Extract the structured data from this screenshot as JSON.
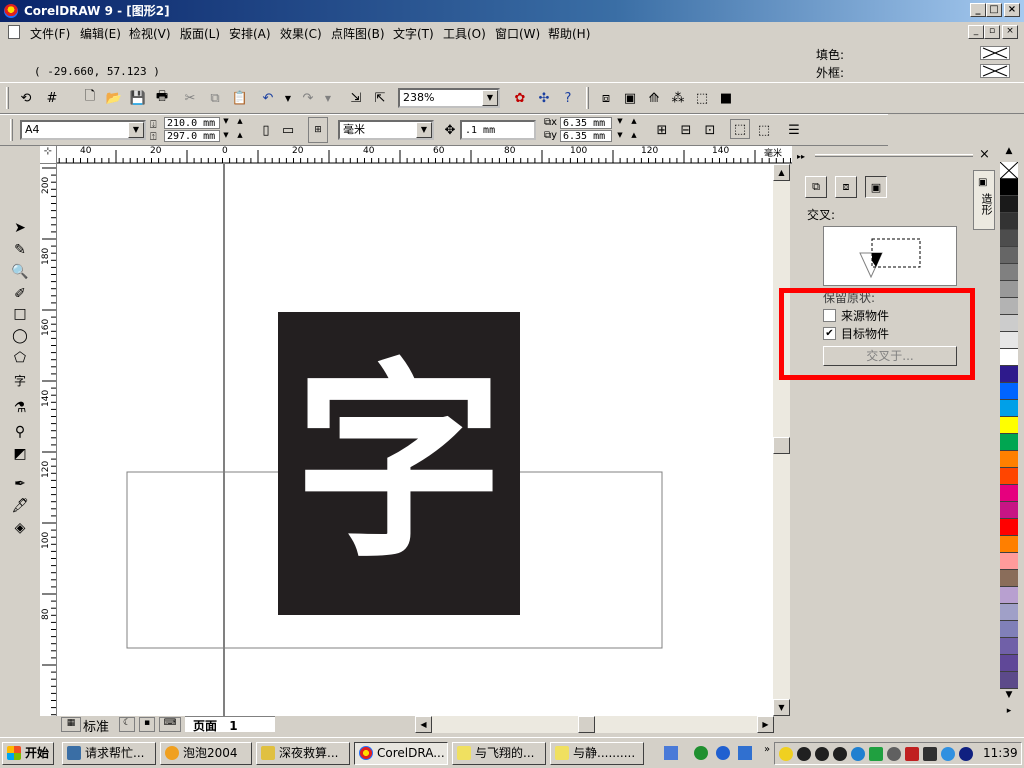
{
  "window": {
    "title": "CorelDRAW 9 - [图形2]"
  },
  "menu": [
    "文件(F)",
    "编辑(E)",
    "检视(V)",
    "版面(L)",
    "安排(A)",
    "效果(C)",
    "点阵图(B)",
    "文字(T)",
    "工具(O)",
    "窗口(W)",
    "帮助(H)"
  ],
  "status": {
    "coordinates": "( -29.660, 57.123 )",
    "fill_label": "填色:",
    "outline_label": "外框:"
  },
  "standard_toolbar": {
    "zoom": "238%"
  },
  "property_bar": {
    "paper": "A4",
    "width": "210.0 mm",
    "height": "297.0 mm",
    "units": "毫米",
    "nudge": ".1 mm",
    "dup_x": "6.35 mm",
    "dup_y": "6.35 mm"
  },
  "rulers": {
    "horizontal_ticks": [
      "40",
      "20",
      "0",
      "20",
      "40",
      "60",
      "80",
      "100",
      "120",
      "140"
    ],
    "horizontal_unit": "毫米",
    "vertical_ticks": [
      "200",
      "180",
      "160",
      "140",
      "120",
      "100",
      "80"
    ]
  },
  "canvas": {
    "glyph": "字"
  },
  "pagebar": {
    "layout_label": "标准",
    "page_tab": "页面",
    "page_number": "1"
  },
  "docker": {
    "tab_label": "造形",
    "section_title": "交叉:",
    "keep_label": "保留原状:",
    "source_label": "来源物件",
    "source_checked": false,
    "target_label": "目标物件",
    "target_checked": true,
    "apply_button": "交叉于...",
    "highlight_color": "#ff0000"
  },
  "palette": {
    "colors": [
      "#000000",
      "#1a1a1a",
      "#333333",
      "#4d4d4d",
      "#666666",
      "#808080",
      "#999999",
      "#b3b3b3",
      "#cccccc",
      "#e6e6e6",
      "#ffffff",
      "#2e1a8c",
      "#0064ff",
      "#00a0e8",
      "#ffff00",
      "#00a651",
      "#ff8000",
      "#ff4500",
      "#e6007e",
      "#c71585",
      "#ff0000",
      "#ff7f00",
      "#ff9b9b",
      "#8a6d5a",
      "#b8a0d0",
      "#a0a0c8",
      "#8080b8",
      "#7060a8",
      "#604898",
      "#5c4a8a",
      "#505078",
      "#4a6a9a",
      "#0080ff"
    ]
  },
  "taskbar": {
    "start": "开始",
    "tasks": [
      "请求帮忙...",
      "泡泡2004",
      "深夜救算...",
      "CorelDRA...",
      "与飞翔的...",
      "与静.........."
    ],
    "clock": "11:39"
  }
}
